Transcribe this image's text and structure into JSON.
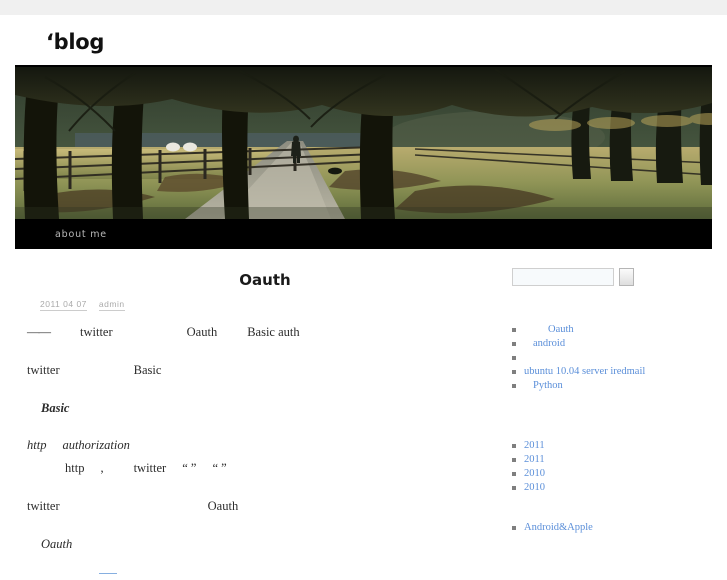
{
  "site": {
    "title": "‘blog",
    "nav": [
      {
        "label": "about me"
      }
    ]
  },
  "banner": {
    "alt": "tree-lined park path with fence"
  },
  "post": {
    "title": "Oauth",
    "meta": {
      "date": "2011  04  07",
      "author": "admin"
    },
    "paragraphs": [
      {
        "segments": [
          "——",
          "twitter",
          "Oauth",
          "Basic auth"
        ]
      },
      {
        "segments": [
          "twitter",
          "Basic"
        ]
      },
      {
        "segments": [
          "Basic"
        ]
      },
      {
        "segments": [
          "http",
          "authorization"
        ]
      },
      {
        "segments": [
          "http",
          ",",
          "twitter",
          "“ ”",
          "“ ”"
        ]
      },
      {
        "segments": [
          "twitter",
          "Oauth"
        ]
      },
      {
        "segments": [
          "Oauth"
        ]
      }
    ]
  },
  "sidebar": {
    "search": {
      "value": "",
      "placeholder": "",
      "button_label": ""
    },
    "recent_posts": [
      {
        "label": "Oauth"
      },
      {
        "label": "android"
      },
      {
        "label": ""
      },
      {
        "label": "ubuntu 10.04 server iredmail"
      },
      {
        "label": "Python"
      }
    ],
    "archives": [
      {
        "label": "2011"
      },
      {
        "label": "2011"
      },
      {
        "label": "2010"
      },
      {
        "label": "2010"
      }
    ],
    "categories": [
      {
        "label": "Android&Apple"
      }
    ]
  },
  "colors": {
    "link": "#5b8fd9",
    "nav_bg": "#000000",
    "top_band": "#f0f0f0",
    "bullet": "#7f7f7f"
  }
}
